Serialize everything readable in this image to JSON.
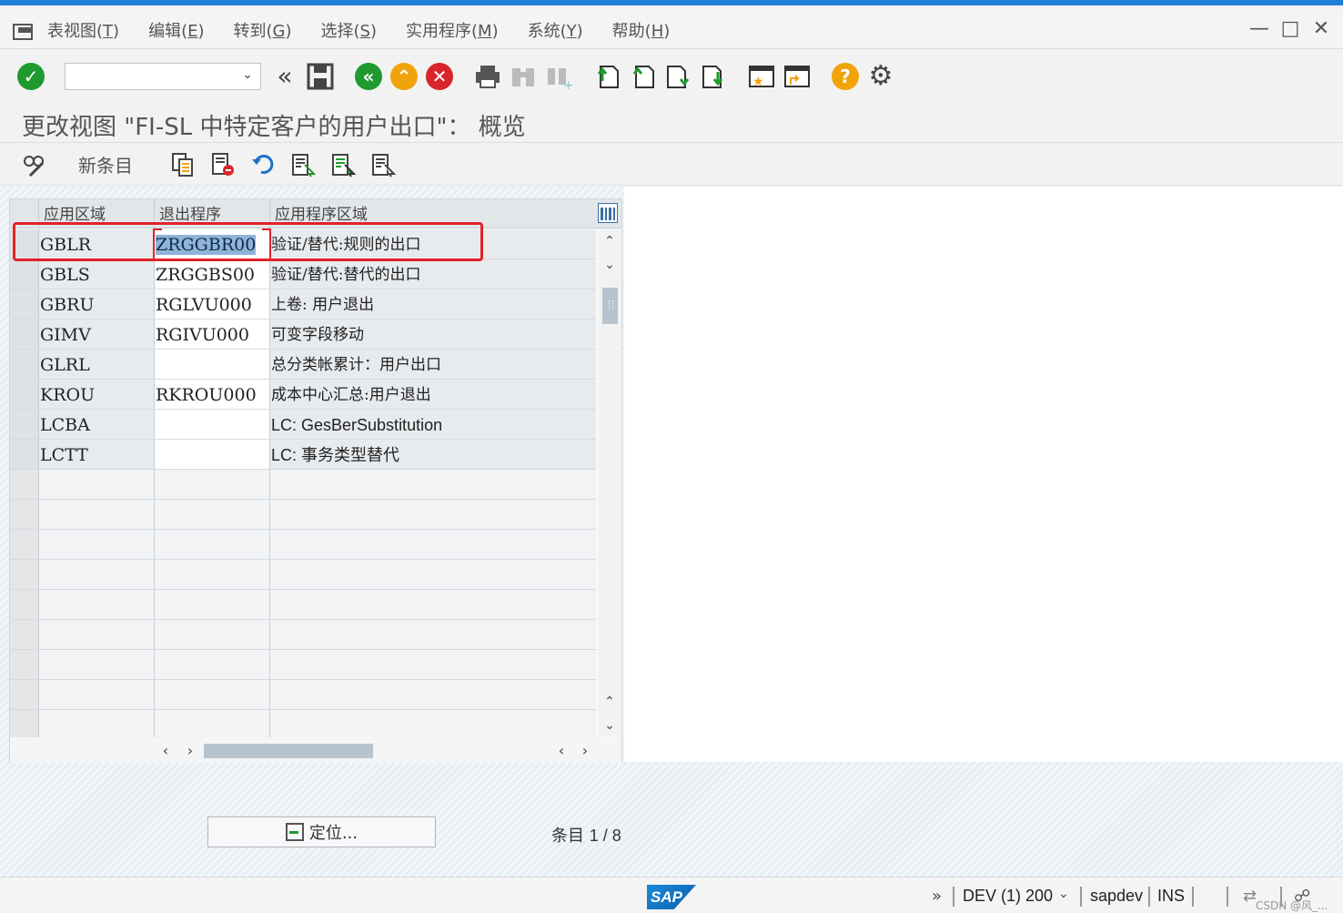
{
  "menu": {
    "items": [
      {
        "label": "表视图",
        "key": "T"
      },
      {
        "label": "编辑",
        "key": "E"
      },
      {
        "label": "转到",
        "key": "G"
      },
      {
        "label": "选择",
        "key": "S"
      },
      {
        "label": "实用程序",
        "key": "M"
      },
      {
        "label": "系统",
        "key": "Y"
      },
      {
        "label": "帮助",
        "key": "H"
      }
    ]
  },
  "command_field": {
    "value": ""
  },
  "title": "更改视图 \"FI-SL 中特定客户的用户出口\"：  概览",
  "app_toolbar": {
    "new_entries": "新条目"
  },
  "table": {
    "columns": [
      "应用区域",
      "退出程序",
      "应用程序区域"
    ],
    "rows": [
      {
        "area": "GBLR",
        "exit": "ZRGGBR00",
        "desc": "验证/替代:规则的出口"
      },
      {
        "area": "GBLS",
        "exit": "ZRGGBS00",
        "desc": "验证/替代:替代的出口"
      },
      {
        "area": "GBRU",
        "exit": "RGLVU000",
        "desc": "上卷: 用户退出"
      },
      {
        "area": "GIMV",
        "exit": "RGIVU000",
        "desc": "可变字段移动"
      },
      {
        "area": "GLRL",
        "exit": "",
        "desc": "总分类帐累计：用户出口"
      },
      {
        "area": "KROU",
        "exit": "RKROU000",
        "desc": "成本中心汇总:用户退出"
      },
      {
        "area": "LCBA",
        "exit": "",
        "desc": "LC: GesBerSubstitution"
      },
      {
        "area": "LCTT",
        "exit": "",
        "desc": "LC: 事务类型替代"
      }
    ]
  },
  "position_button": {
    "label": "定位..."
  },
  "entry_info": {
    "label": "条目",
    "value": "1 / 8"
  },
  "status": {
    "sap": "SAP",
    "system": "DEV (1) 200",
    "user": "sapdev",
    "mode": "INS",
    "watermark": "CSDN @风_..."
  }
}
